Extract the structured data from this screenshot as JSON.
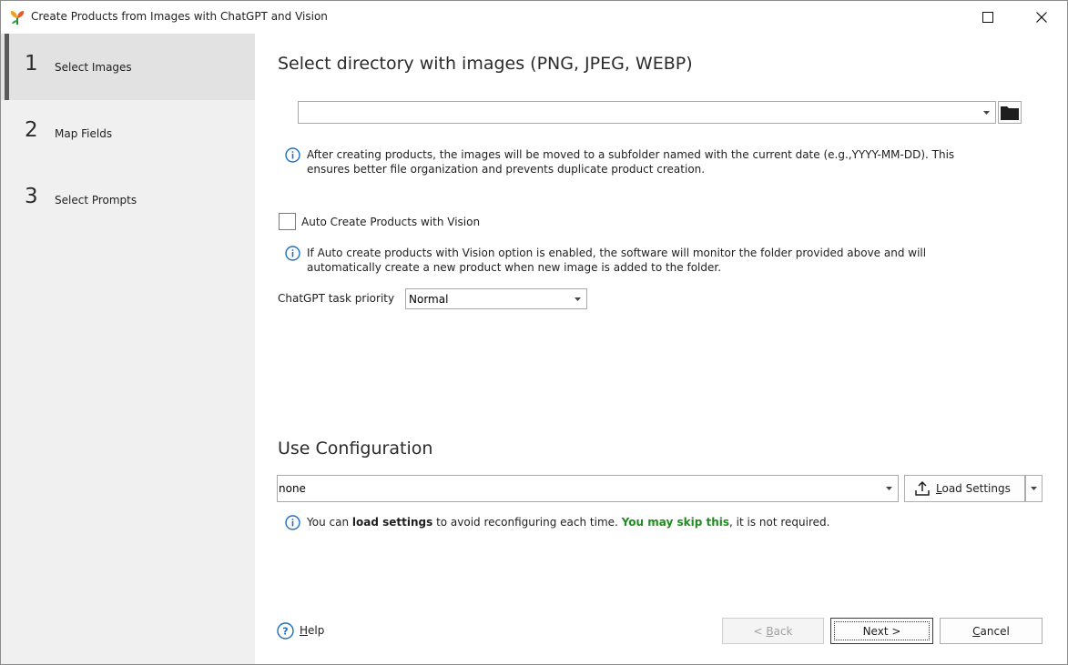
{
  "window": {
    "title": "Create Products from Images with ChatGPT and Vision"
  },
  "sidebar": {
    "steps": [
      {
        "number": "1",
        "label": "Select Images",
        "active": true
      },
      {
        "number": "2",
        "label": "Map Fields",
        "active": false
      },
      {
        "number": "3",
        "label": "Select Prompts",
        "active": false
      }
    ]
  },
  "main": {
    "directory_heading": "Select directory with images (PNG, JPEG, WEBP)",
    "directory_value": "",
    "directory_info_line1": "After creating products, the images will be moved to a subfolder named with the current date (e.g.,YYYY-MM-DD). This",
    "directory_info_line2": "ensures better file organization and prevents duplicate product creation.",
    "auto_create_label": "Auto Create Products with Vision",
    "auto_create_checked": false,
    "auto_info_line1": "If Auto create products with Vision option is enabled, the software will monitor the folder provided above and will",
    "auto_info_line2": "automatically create a new product when new image is added to the folder.",
    "priority_label": "ChatGPT task priority",
    "priority_value": "Normal",
    "config_heading": "Use Configuration",
    "config_value": "none",
    "load_settings_prefix": "",
    "load_settings_underlined": "L",
    "load_settings_rest": "oad Settings",
    "config_info_part1": "You can ",
    "config_info_bold": "load settings",
    "config_info_part2": " to avoid reconfiguring each time. ",
    "config_info_green": "You may skip this",
    "config_info_part3": ", it is not required."
  },
  "footer": {
    "help_underlined": "H",
    "help_rest": "elp",
    "back_prefix": "< ",
    "back_underlined": "B",
    "back_rest": "ack",
    "next_label": "Next >",
    "cancel_underlined": "C",
    "cancel_rest": "ancel"
  },
  "colors": {
    "sidebar_bg": "#f0f0f0",
    "active_step_bg": "#e2e2e2",
    "info_blue": "#1a6fc4",
    "green_text": "#1e8c1e"
  }
}
